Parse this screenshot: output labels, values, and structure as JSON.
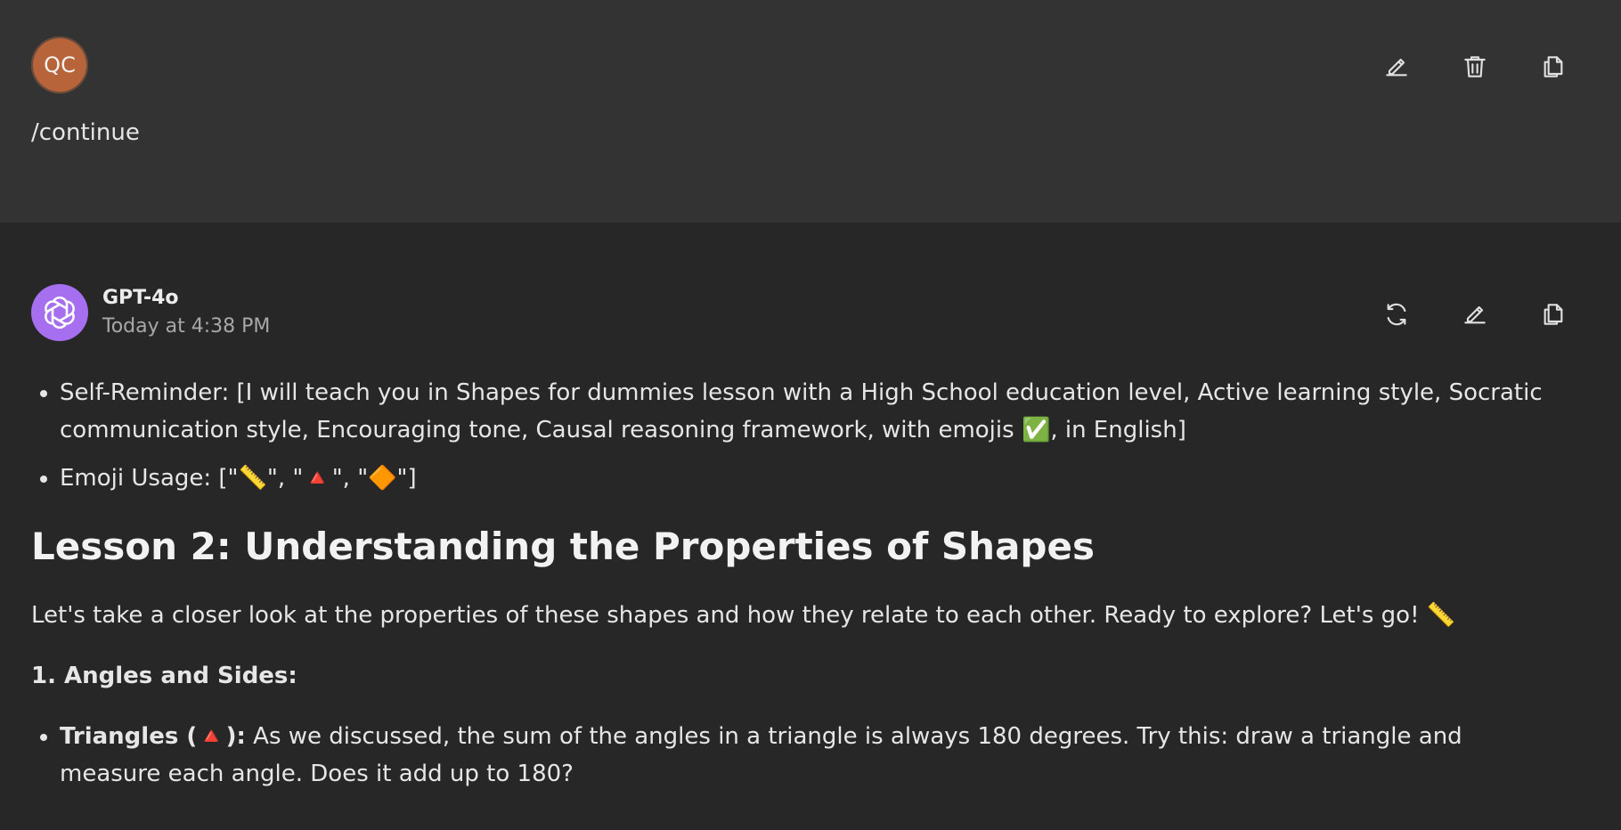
{
  "user_message": {
    "avatar_initials": "QC",
    "avatar_color": "#b7643a",
    "text": "/continue",
    "actions": [
      "edit-icon",
      "delete-icon",
      "copy-icon"
    ]
  },
  "assistant_message": {
    "avatar_color": "#a56ff0",
    "model_name": "GPT-4o",
    "timestamp": "Today at 4:38 PM",
    "actions": [
      "regenerate-icon",
      "edit-icon",
      "copy-icon"
    ],
    "bullets": [
      "Self-Reminder: [I will teach you in Shapes for dummies lesson with a High School education level, Active learning style, Socratic communication style, Encouraging tone, Causal reasoning framework, with emojis ✅, in English]",
      "Emoji Usage: [\"📏\", \"🔺\", \"🔶\"]"
    ],
    "lesson_title": "Lesson 2: Understanding the Properties of Shapes",
    "intro": "Let's take a closer look at the properties of these shapes and how they relate to each other. Ready to explore? Let's go! 📏",
    "section_heading": "1. Angles and Sides:",
    "section_items": [
      {
        "label": "Triangles (🔺):",
        "text": " As we discussed, the sum of the angles in a triangle is always 180 degrees. Try this: draw a triangle and measure each angle. Does it add up to 180?"
      }
    ]
  }
}
